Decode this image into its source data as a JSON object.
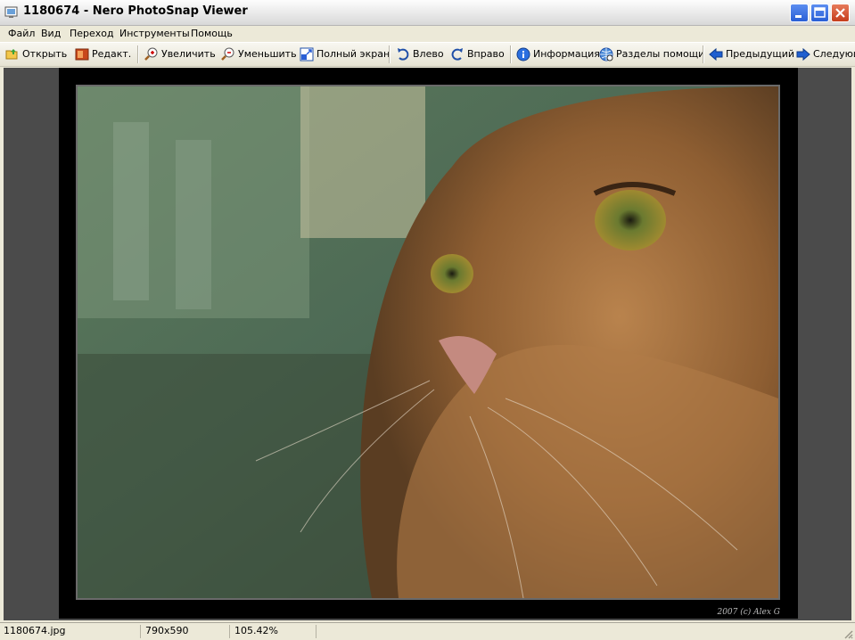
{
  "window": {
    "title": "1180674 - Nero PhotoSnap Viewer"
  },
  "menu": [
    "Файл",
    "Вид",
    "Переход",
    "Инструменты",
    "Помощь"
  ],
  "toolbar": {
    "open": "Открыть",
    "edit": "Редакт.",
    "zoom_in": "Увеличить",
    "zoom_out": "Уменьшить",
    "fullscreen": "Полный экран",
    "rotate_left": "Влево",
    "rotate_right": "Вправо",
    "info": "Информация",
    "help": "Разделы помощи",
    "prev": "Предыдущий",
    "next": "Следующий"
  },
  "image": {
    "signature": "2007 (c) Alex G"
  },
  "status": {
    "filename": "1180674.jpg",
    "dimensions": "790x590",
    "zoom": "105.42%"
  },
  "colors": {
    "accent": "#2a5fd6",
    "close": "#c53d1c",
    "viewer_bg": "#4b4b4b"
  }
}
